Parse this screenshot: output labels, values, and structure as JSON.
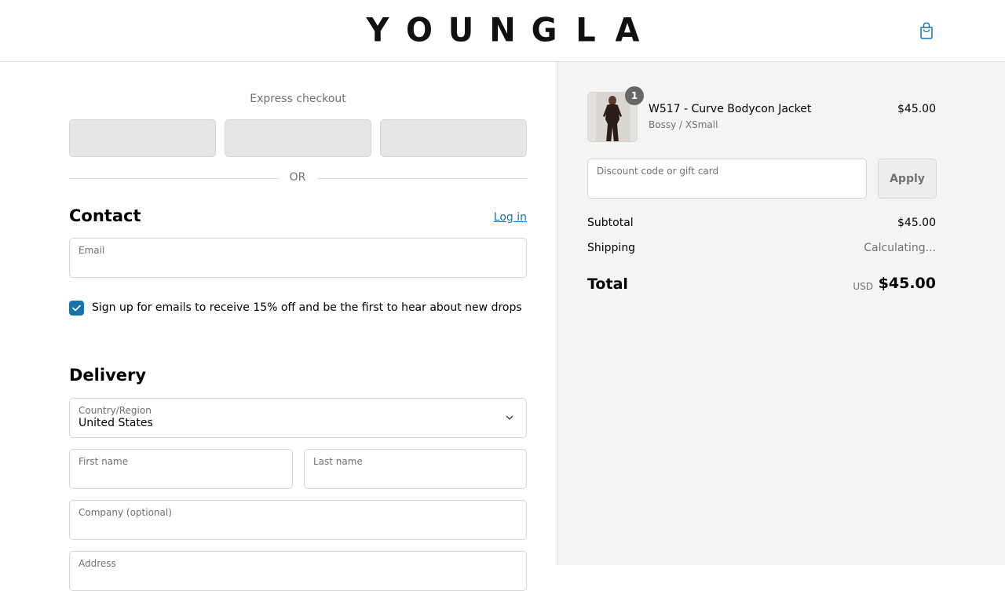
{
  "header": {
    "logo_letters": [
      "Y",
      "O",
      "U",
      "N",
      "G",
      "L",
      "A"
    ],
    "cart_icon": "shopping-bag-icon"
  },
  "express": {
    "title": "Express checkout",
    "or_text": "OR"
  },
  "contact": {
    "title": "Contact",
    "login_label": "Log in",
    "email_label": "Email",
    "newsletter_label": "Sign up for emails to receive 15% off and be the first to hear about new drops",
    "newsletter_checked": true
  },
  "delivery": {
    "title": "Delivery",
    "country_label": "Country/Region",
    "country_value": "United States",
    "first_name_label": "First name",
    "last_name_label": "Last name",
    "company_label": "Company (optional)",
    "address_label": "Address"
  },
  "summary": {
    "item": {
      "quantity": "1",
      "name": "W517 - Curve Bodycon Jacket",
      "variant": "Bossy / XSmall",
      "price": "$45.00"
    },
    "discount_label": "Discount code or gift card",
    "apply_label": "Apply",
    "subtotal_label": "Subtotal",
    "subtotal_value": "$45.00",
    "shipping_label": "Shipping",
    "shipping_value": "Calculating...",
    "total_label": "Total",
    "total_currency": "USD",
    "total_value": "$45.00"
  },
  "colors": {
    "accent": "#1773b0",
    "sidebar_bg": "#f4f4f4",
    "border": "#d6d6d6"
  }
}
